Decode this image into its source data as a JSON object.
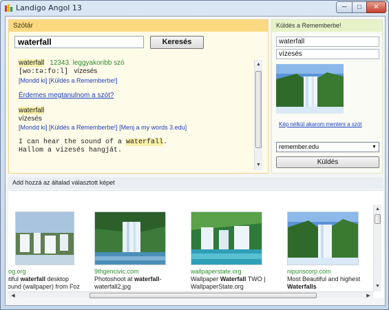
{
  "window": {
    "title": "Landigo Angol 13"
  },
  "dictionary": {
    "header": "Szótár",
    "search_value": "waterfall",
    "search_button": "Keresés",
    "entry1": {
      "word": "waterfall",
      "rank": "12343. leggyakoribb szó",
      "phonetic": "[wo:tə:fo:l]",
      "meaning": "vízesés",
      "links": "[Mondd ki] [Küldés a Rememberbe!]"
    },
    "learn_link": "Érdemes megtanulnom a szót?",
    "entry2": {
      "word": "waterfall",
      "meaning": "vízesés",
      "links": "[Mondd ki] [Küldés a Rememberbe!] [Menj a my words 3.edu]"
    },
    "example": {
      "before": "I can hear the sound of a ",
      "word": "waterfall",
      "after": ".",
      "translation": "Hallom a vízesés hangját."
    }
  },
  "send": {
    "header": "Küldés a Rememberbe!",
    "word": "waterfall",
    "meaning": "vízesés",
    "no_image_link": "Kép nélkül akarom menteni a szót",
    "select_value": "remember.edu",
    "send_button": "Küldés"
  },
  "images": {
    "header": "Add hozzá az általad választott képet",
    "results": [
      {
        "source": "ilog.org",
        "desc_before": "utiful ",
        "desc_bold": "waterfall",
        "desc_after": " desktop",
        "line2": "round (wallpaper) from Foz",
        "line2_bold": ""
      },
      {
        "source": "9thgencivic.com",
        "desc_before": "Photoshoot at ",
        "desc_bold": "waterfall",
        "desc_after": "-",
        "line2": "waterfall2.jpg",
        "line2_bold": ""
      },
      {
        "source": "wallpaperstate.org",
        "desc_before": "Wallpaper ",
        "desc_bold": "Waterfall",
        "desc_after": " TWO |",
        "line2": "WallpaperState.org",
        "line2_bold": ""
      },
      {
        "source": "nipunscorp.com",
        "desc_before": "Most Beautiful and highest",
        "desc_bold": "",
        "desc_after": "",
        "line2": "",
        "line2_bold": "Waterfalls"
      }
    ]
  }
}
